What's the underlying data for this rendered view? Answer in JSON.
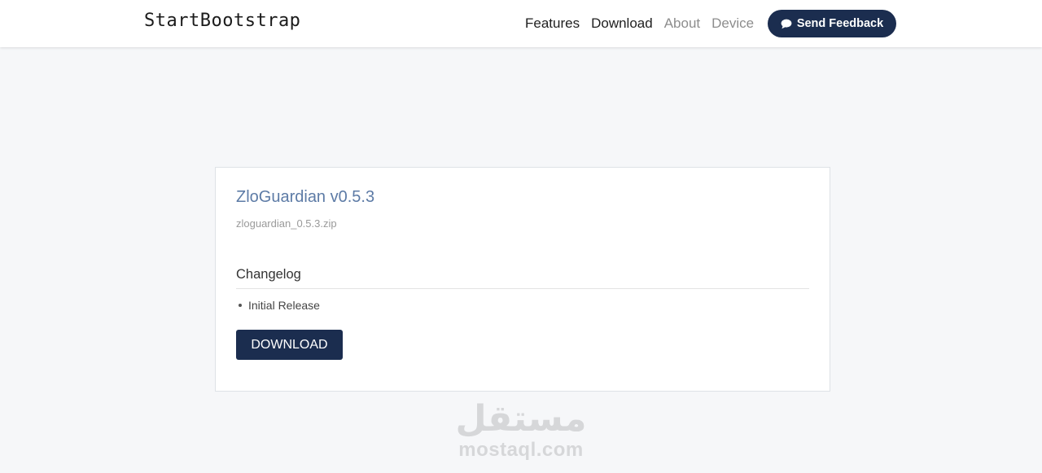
{
  "navbar": {
    "brand": "StartBootstrap",
    "links": [
      {
        "label": "Features",
        "state": "dark"
      },
      {
        "label": "Download",
        "state": "dark"
      },
      {
        "label": "About",
        "state": "muted"
      },
      {
        "label": "Device",
        "state": "muted"
      }
    ],
    "feedback_button": {
      "label": "Send Feedback",
      "icon": "chat-bubble-icon"
    }
  },
  "release": {
    "title": "ZloGuardian v0.5.3",
    "filename": "zloguardian_0.5.3.zip",
    "changelog_title": "Changelog",
    "changelog_items": [
      "Initial Release"
    ],
    "download_label": "DOWNLOAD"
  },
  "watermark": {
    "arabic": "مستقل",
    "latin": "mostaql.com"
  },
  "colors": {
    "accent": "#1b2d4f",
    "title": "#5d7ba6",
    "background": "#f6f7f9"
  }
}
